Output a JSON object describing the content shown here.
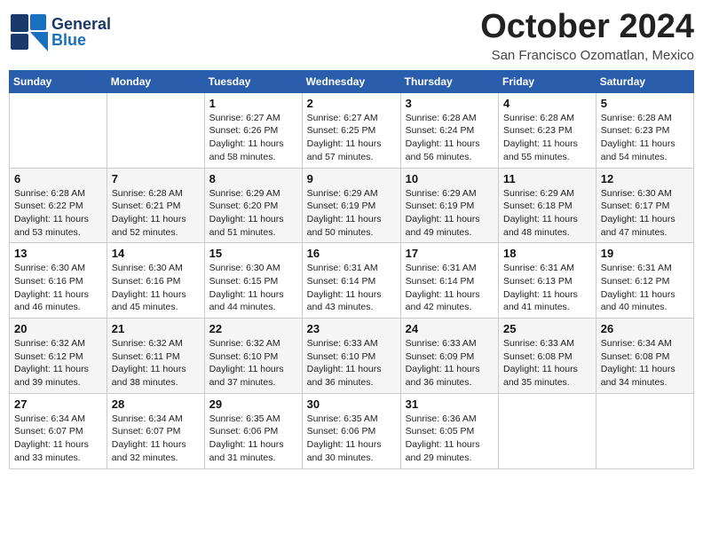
{
  "header": {
    "logo": {
      "line1": "General",
      "line2": "Blue"
    },
    "title": "October 2024",
    "location": "San Francisco Ozomatlan, Mexico"
  },
  "weekdays": [
    "Sunday",
    "Monday",
    "Tuesday",
    "Wednesday",
    "Thursday",
    "Friday",
    "Saturday"
  ],
  "weeks": [
    [
      null,
      null,
      {
        "day": 1,
        "sunrise": "6:27 AM",
        "sunset": "6:26 PM",
        "daylight": "11 hours and 58 minutes."
      },
      {
        "day": 2,
        "sunrise": "6:27 AM",
        "sunset": "6:25 PM",
        "daylight": "11 hours and 57 minutes."
      },
      {
        "day": 3,
        "sunrise": "6:28 AM",
        "sunset": "6:24 PM",
        "daylight": "11 hours and 56 minutes."
      },
      {
        "day": 4,
        "sunrise": "6:28 AM",
        "sunset": "6:23 PM",
        "daylight": "11 hours and 55 minutes."
      },
      {
        "day": 5,
        "sunrise": "6:28 AM",
        "sunset": "6:23 PM",
        "daylight": "11 hours and 54 minutes."
      }
    ],
    [
      {
        "day": 6,
        "sunrise": "6:28 AM",
        "sunset": "6:22 PM",
        "daylight": "11 hours and 53 minutes."
      },
      {
        "day": 7,
        "sunrise": "6:28 AM",
        "sunset": "6:21 PM",
        "daylight": "11 hours and 52 minutes."
      },
      {
        "day": 8,
        "sunrise": "6:29 AM",
        "sunset": "6:20 PM",
        "daylight": "11 hours and 51 minutes."
      },
      {
        "day": 9,
        "sunrise": "6:29 AM",
        "sunset": "6:19 PM",
        "daylight": "11 hours and 50 minutes."
      },
      {
        "day": 10,
        "sunrise": "6:29 AM",
        "sunset": "6:19 PM",
        "daylight": "11 hours and 49 minutes."
      },
      {
        "day": 11,
        "sunrise": "6:29 AM",
        "sunset": "6:18 PM",
        "daylight": "11 hours and 48 minutes."
      },
      {
        "day": 12,
        "sunrise": "6:30 AM",
        "sunset": "6:17 PM",
        "daylight": "11 hours and 47 minutes."
      }
    ],
    [
      {
        "day": 13,
        "sunrise": "6:30 AM",
        "sunset": "6:16 PM",
        "daylight": "11 hours and 46 minutes."
      },
      {
        "day": 14,
        "sunrise": "6:30 AM",
        "sunset": "6:16 PM",
        "daylight": "11 hours and 45 minutes."
      },
      {
        "day": 15,
        "sunrise": "6:30 AM",
        "sunset": "6:15 PM",
        "daylight": "11 hours and 44 minutes."
      },
      {
        "day": 16,
        "sunrise": "6:31 AM",
        "sunset": "6:14 PM",
        "daylight": "11 hours and 43 minutes."
      },
      {
        "day": 17,
        "sunrise": "6:31 AM",
        "sunset": "6:14 PM",
        "daylight": "11 hours and 42 minutes."
      },
      {
        "day": 18,
        "sunrise": "6:31 AM",
        "sunset": "6:13 PM",
        "daylight": "11 hours and 41 minutes."
      },
      {
        "day": 19,
        "sunrise": "6:31 AM",
        "sunset": "6:12 PM",
        "daylight": "11 hours and 40 minutes."
      }
    ],
    [
      {
        "day": 20,
        "sunrise": "6:32 AM",
        "sunset": "6:12 PM",
        "daylight": "11 hours and 39 minutes."
      },
      {
        "day": 21,
        "sunrise": "6:32 AM",
        "sunset": "6:11 PM",
        "daylight": "11 hours and 38 minutes."
      },
      {
        "day": 22,
        "sunrise": "6:32 AM",
        "sunset": "6:10 PM",
        "daylight": "11 hours and 37 minutes."
      },
      {
        "day": 23,
        "sunrise": "6:33 AM",
        "sunset": "6:10 PM",
        "daylight": "11 hours and 36 minutes."
      },
      {
        "day": 24,
        "sunrise": "6:33 AM",
        "sunset": "6:09 PM",
        "daylight": "11 hours and 36 minutes."
      },
      {
        "day": 25,
        "sunrise": "6:33 AM",
        "sunset": "6:08 PM",
        "daylight": "11 hours and 35 minutes."
      },
      {
        "day": 26,
        "sunrise": "6:34 AM",
        "sunset": "6:08 PM",
        "daylight": "11 hours and 34 minutes."
      }
    ],
    [
      {
        "day": 27,
        "sunrise": "6:34 AM",
        "sunset": "6:07 PM",
        "daylight": "11 hours and 33 minutes."
      },
      {
        "day": 28,
        "sunrise": "6:34 AM",
        "sunset": "6:07 PM",
        "daylight": "11 hours and 32 minutes."
      },
      {
        "day": 29,
        "sunrise": "6:35 AM",
        "sunset": "6:06 PM",
        "daylight": "11 hours and 31 minutes."
      },
      {
        "day": 30,
        "sunrise": "6:35 AM",
        "sunset": "6:06 PM",
        "daylight": "11 hours and 30 minutes."
      },
      {
        "day": 31,
        "sunrise": "6:36 AM",
        "sunset": "6:05 PM",
        "daylight": "11 hours and 29 minutes."
      },
      null,
      null
    ]
  ]
}
